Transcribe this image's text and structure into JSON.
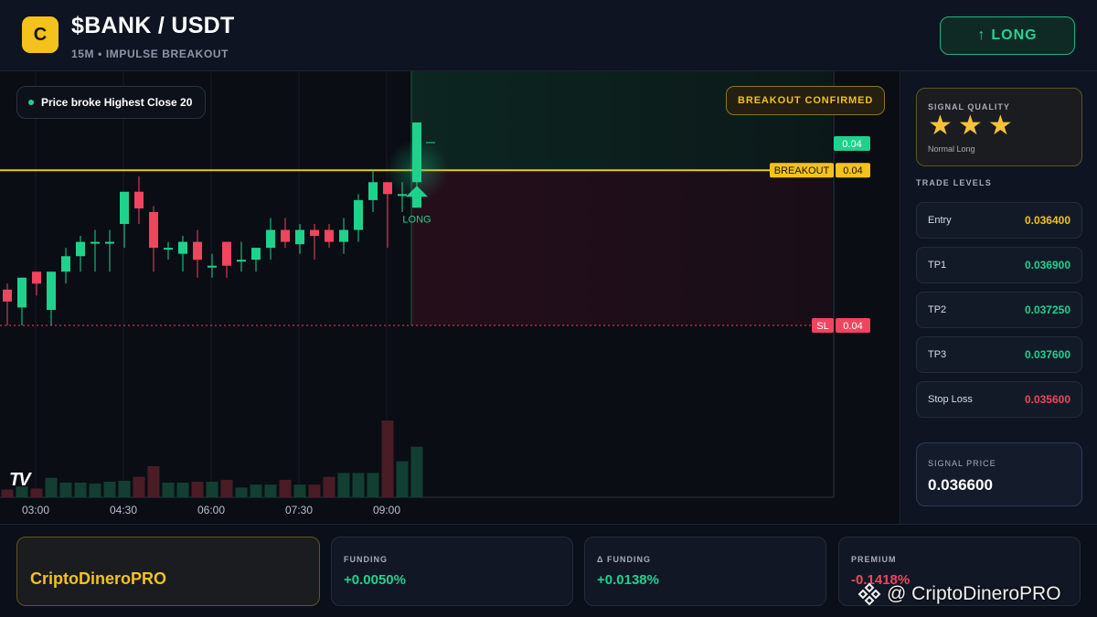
{
  "header": {
    "logo_letter": "C",
    "title": "$BANK / USDT",
    "subtitle": "15M • IMPULSE BREAKOUT",
    "long_button": "LONG"
  },
  "chart": {
    "info_pill": "Price broke Highest Close 20",
    "confirm_pill": "BREAKOUT CONFIRMED",
    "signal_label": "LONG",
    "tv_logo": "TV",
    "price_tags": {
      "top": "0.04",
      "breakout_label": "BREAKOUT",
      "breakout_value": "0.04",
      "sl_label": "SL",
      "sl_value": "0.04"
    },
    "time_labels": [
      "03:00",
      "04:30",
      "06:00",
      "07:30",
      "09:00"
    ],
    "colors": {
      "up": "#1fd28c",
      "down": "#f0445f",
      "breakout": "#f3c21c"
    }
  },
  "chart_data": {
    "type": "candlestick",
    "x_ticks": [
      "03:00",
      "04:30",
      "06:00",
      "07:30",
      "09:00"
    ],
    "candles": [
      {
        "o": 0.0359,
        "h": 0.03595,
        "l": 0.0356,
        "c": 0.0358,
        "v": 8
      },
      {
        "o": 0.03575,
        "h": 0.036,
        "l": 0.0356,
        "c": 0.036,
        "v": 11
      },
      {
        "o": 0.03605,
        "h": 0.03605,
        "l": 0.03585,
        "c": 0.03595,
        "v": 9
      },
      {
        "o": 0.03573,
        "h": 0.03605,
        "l": 0.0356,
        "c": 0.03605,
        "v": 20
      },
      {
        "o": 0.03605,
        "h": 0.03625,
        "l": 0.03595,
        "c": 0.03618,
        "v": 15
      },
      {
        "o": 0.03618,
        "h": 0.03635,
        "l": 0.03605,
        "c": 0.0363,
        "v": 15
      },
      {
        "o": 0.0363,
        "h": 0.0364,
        "l": 0.03605,
        "c": 0.0363,
        "v": 14
      },
      {
        "o": 0.0363,
        "h": 0.0364,
        "l": 0.03605,
        "c": 0.0363,
        "v": 16
      },
      {
        "o": 0.03645,
        "h": 0.03665,
        "l": 0.03625,
        "c": 0.03672,
        "v": 17
      },
      {
        "o": 0.03672,
        "h": 0.03685,
        "l": 0.03645,
        "c": 0.03658,
        "v": 21
      },
      {
        "o": 0.03655,
        "h": 0.0366,
        "l": 0.03605,
        "c": 0.03625,
        "v": 32
      },
      {
        "o": 0.03625,
        "h": 0.0363,
        "l": 0.03615,
        "c": 0.03625,
        "v": 15
      },
      {
        "o": 0.0362,
        "h": 0.03635,
        "l": 0.03605,
        "c": 0.0363,
        "v": 15
      },
      {
        "o": 0.0363,
        "h": 0.0364,
        "l": 0.036,
        "c": 0.03615,
        "v": 16
      },
      {
        "o": 0.0361,
        "h": 0.0362,
        "l": 0.036,
        "c": 0.0361,
        "v": 16
      },
      {
        "o": 0.0363,
        "h": 0.0363,
        "l": 0.036,
        "c": 0.0361,
        "v": 18
      },
      {
        "o": 0.03615,
        "h": 0.0363,
        "l": 0.03605,
        "c": 0.03615,
        "v": 10
      },
      {
        "o": 0.03615,
        "h": 0.03625,
        "l": 0.03605,
        "c": 0.03625,
        "v": 13
      },
      {
        "o": 0.03625,
        "h": 0.0365,
        "l": 0.03615,
        "c": 0.0364,
        "v": 13
      },
      {
        "o": 0.0364,
        "h": 0.0365,
        "l": 0.03625,
        "c": 0.0363,
        "v": 18
      },
      {
        "o": 0.03628,
        "h": 0.03645,
        "l": 0.0362,
        "c": 0.0364,
        "v": 13
      },
      {
        "o": 0.0364,
        "h": 0.03645,
        "l": 0.03615,
        "c": 0.03635,
        "v": 13
      },
      {
        "o": 0.0364,
        "h": 0.03645,
        "l": 0.03625,
        "c": 0.0363,
        "v": 21
      },
      {
        "o": 0.0363,
        "h": 0.0365,
        "l": 0.0362,
        "c": 0.0364,
        "v": 25
      },
      {
        "o": 0.0364,
        "h": 0.0367,
        "l": 0.0363,
        "c": 0.03665,
        "v": 25
      },
      {
        "o": 0.03665,
        "h": 0.0369,
        "l": 0.03655,
        "c": 0.0368,
        "v": 25
      },
      {
        "o": 0.0368,
        "h": 0.0368,
        "l": 0.03625,
        "c": 0.0367,
        "v": 79
      },
      {
        "o": 0.0367,
        "h": 0.0368,
        "l": 0.03655,
        "c": 0.0367,
        "v": 37
      },
      {
        "o": 0.0368,
        "h": 0.0373,
        "l": 0.0367,
        "c": 0.0373,
        "v": 52
      }
    ],
    "levels": {
      "breakout": 0.0369,
      "stop_loss": 0.0356,
      "entry": 0.0364
    }
  },
  "panel": {
    "quality_label": "SIGNAL QUALITY",
    "stars": [
      "★",
      "★",
      "★"
    ],
    "quality_sub": "Normal Long",
    "levels_title": "TRADE LEVELS",
    "levels": [
      {
        "label": "Entry",
        "value": "0.036400",
        "color": "#f3c21c"
      },
      {
        "label": "TP1",
        "value": "0.036900",
        "color": "#1fd28c"
      },
      {
        "label": "TP2",
        "value": "0.037250",
        "color": "#1fd28c"
      },
      {
        "label": "TP3",
        "value": "0.037600",
        "color": "#1fd28c"
      },
      {
        "label": "Stop Loss",
        "value": "0.035600",
        "color": "#f0445f"
      }
    ],
    "signal_price_label": "SIGNAL PRICE",
    "signal_price": "0.036600"
  },
  "footer": {
    "brand": "CriptoDineroPRO",
    "funding_label": "FUNDING",
    "funding_value": "+0.0050%",
    "delta_label": "Δ FUNDING",
    "delta_value": "+0.0138%",
    "premium_label": "PREMIUM",
    "premium_value": "-0.1418%",
    "watermark": "@ CriptoDineroPRO"
  }
}
